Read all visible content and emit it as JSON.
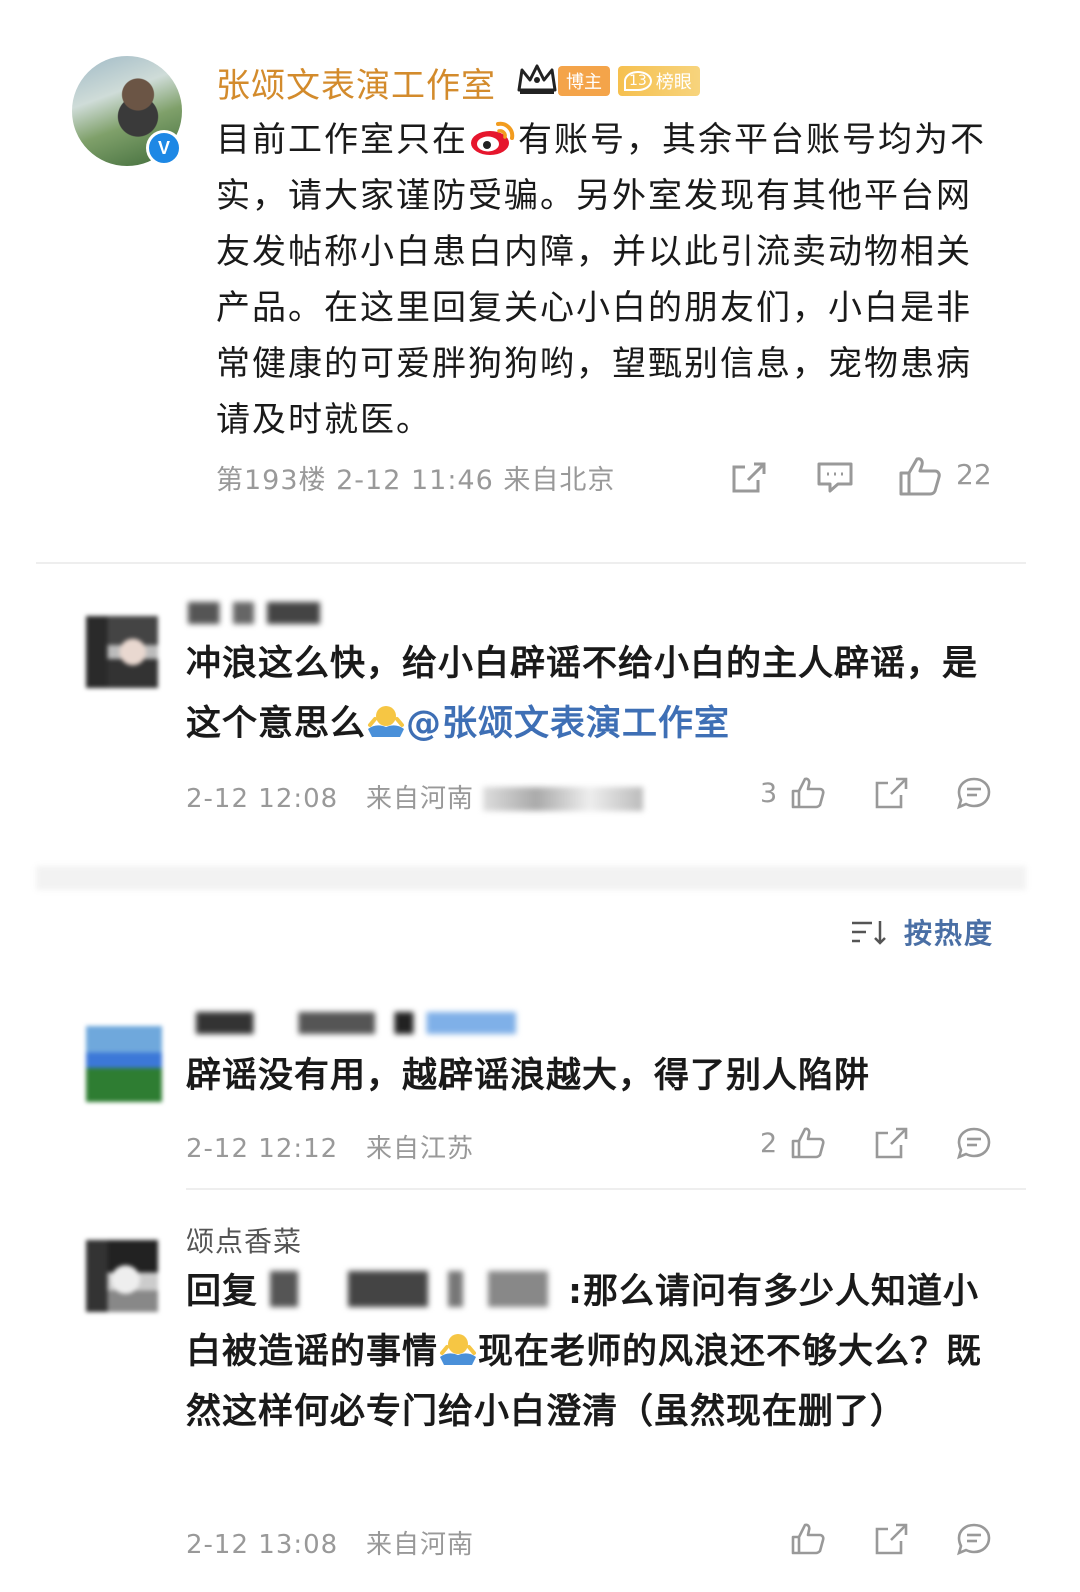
{
  "post": {
    "author": "张颂文表演工作室",
    "badge_verified": "V",
    "tag_boss": "博主",
    "tag_rank_num": "13",
    "tag_rank_label": "榜眼",
    "text_before_logo": "目前工作室只在",
    "text_after_logo": "有账号，其余平台账号均为不实，请大家谨防受骗。另外室发现有其他平台网友发帖称小白患白内障，并以此引流卖动物相关产品。在这里回复关心小白的朋友们，小白是非常健康的可爱胖狗狗哟，望甄别信息，宠物患病请及时就医。",
    "meta": "第193楼 2-12 11:46 来自北京",
    "like_count": "22"
  },
  "reply_top": {
    "text": "冲浪这么快，给小白辟谣不给小白的主人辟谣，是这个意思么",
    "mention": "@张颂文表演工作室",
    "time": "2-12 12:08",
    "location": "来自河南",
    "like_count": "3"
  },
  "sort": {
    "label": "按热度"
  },
  "comments": [
    {
      "text": "辟谣没有用，越辟谣浪越大，得了别人陷阱",
      "time": "2-12 12:12",
      "location": "来自江苏",
      "like_count": "2"
    },
    {
      "username": "颂点香菜",
      "reply_prefix": "回复",
      "reply_suffix": ":那么请问有多少人知道小白被造谣的事情",
      "text_after_emoji": "现在老师的风浪还不够大么？既然这样何必专门给小白澄清（虽然现在删了）",
      "time": "2-12 13:08",
      "location": "来自河南"
    }
  ],
  "colors": {
    "author": "#d38b2c",
    "mention": "#3e6fb5",
    "meta": "#999999"
  },
  "icons": [
    "weibo-logo",
    "share-icon",
    "comment-icon",
    "like-icon",
    "sort-icon",
    "shrug-emoji",
    "crown-icon"
  ]
}
